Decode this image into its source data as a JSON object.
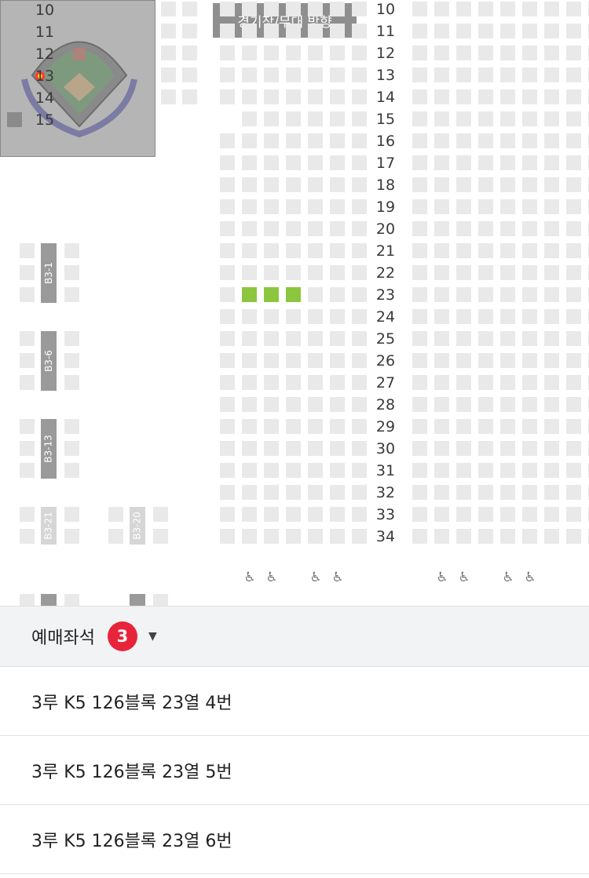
{
  "seat_map": {
    "stage_label": "경기장/무대 방향",
    "row_numbers": [
      "10",
      "11",
      "12",
      "13",
      "14",
      "15",
      "16",
      "17",
      "18",
      "19",
      "20",
      "21",
      "22",
      "23",
      "24",
      "25",
      "26",
      "27",
      "28",
      "29",
      "30",
      "31",
      "32",
      "33",
      "34"
    ],
    "minimap_row_numbers": [
      "10",
      "11",
      "12",
      "13",
      "14",
      "15"
    ],
    "block_labels": [
      "B3-1",
      "B3-6",
      "B3-13",
      "B3-21",
      "B3-20"
    ],
    "selected_seat_count": 3,
    "colors": {
      "available": "#e9e9e9",
      "selected": "#8cc63f",
      "badge": "#e8243a"
    },
    "icons": {
      "wheelchair": "wheelchair-icon"
    }
  },
  "panel": {
    "title": "예매좌석",
    "count": "3",
    "toggle_icon": "caret-down-icon",
    "seats": [
      "3루 K5 126블록 23열 4번",
      "3루 K5 126블록 23열 5번",
      "3루 K5 126블록 23열 6번"
    ]
  }
}
